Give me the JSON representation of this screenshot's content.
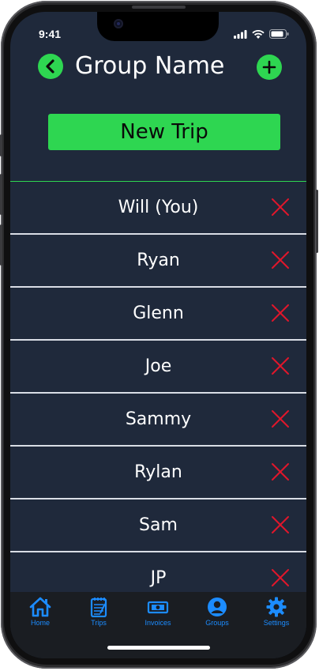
{
  "status": {
    "time": "9:41"
  },
  "header": {
    "title": "Group Name"
  },
  "actions": {
    "new_trip_label": "New Trip"
  },
  "members": [
    {
      "name": "Will (You)"
    },
    {
      "name": "Ryan"
    },
    {
      "name": "Glenn"
    },
    {
      "name": "Joe"
    },
    {
      "name": "Sammy"
    },
    {
      "name": "Rylan"
    },
    {
      "name": "Sam"
    },
    {
      "name": "JP"
    }
  ],
  "tabs": [
    {
      "label": "Home",
      "icon": "home-icon"
    },
    {
      "label": "Trips",
      "icon": "notepad-icon"
    },
    {
      "label": "Invoices",
      "icon": "banknote-icon"
    },
    {
      "label": "Groups",
      "icon": "person-circle-icon"
    },
    {
      "label": "Settings",
      "icon": "gear-icon"
    }
  ],
  "colors": {
    "accent": "#2ed651",
    "background": "#1f293b",
    "remove": "#e0162b",
    "tab": "#1c8cff"
  }
}
